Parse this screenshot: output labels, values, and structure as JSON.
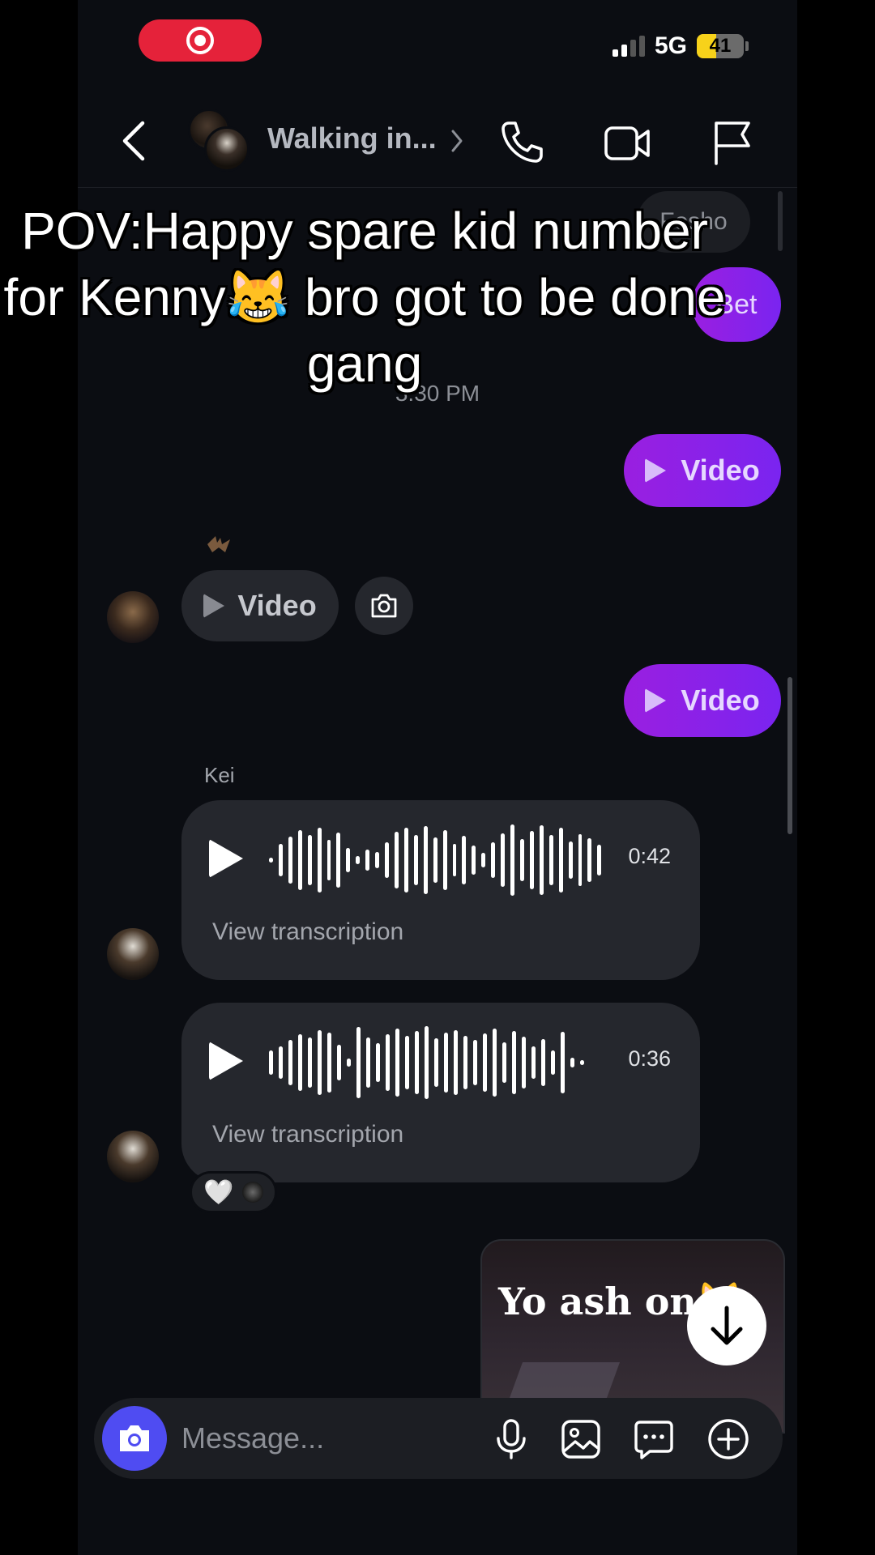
{
  "status_bar": {
    "network": "5G",
    "battery": "41",
    "battery_level": 0.41
  },
  "header": {
    "title": "Walking in..."
  },
  "messages": {
    "fosho": "Fosho",
    "bet": "Bet",
    "time": "3:30 PM",
    "video_sent_1": "Video",
    "video_received": "Video",
    "video_sent_2": "Video",
    "sender": "Kei",
    "voice_1": {
      "duration": "0:42",
      "transcription": "View transcription"
    },
    "voice_2": {
      "duration": "0:36",
      "transcription": "View transcription"
    },
    "reaction": "🤍",
    "shared_post_text": "Yo ash on😹"
  },
  "composer": {
    "placeholder": "Message..."
  },
  "overlay": {
    "caption": "POV:Happy spare kid number for Kenny😹 bro got to be done gang"
  },
  "colors": {
    "sent_bubble": "#8a22e8",
    "received_bubble": "#25272d",
    "camera_button": "#4f4cf2",
    "record_pill": "#e5223a"
  }
}
